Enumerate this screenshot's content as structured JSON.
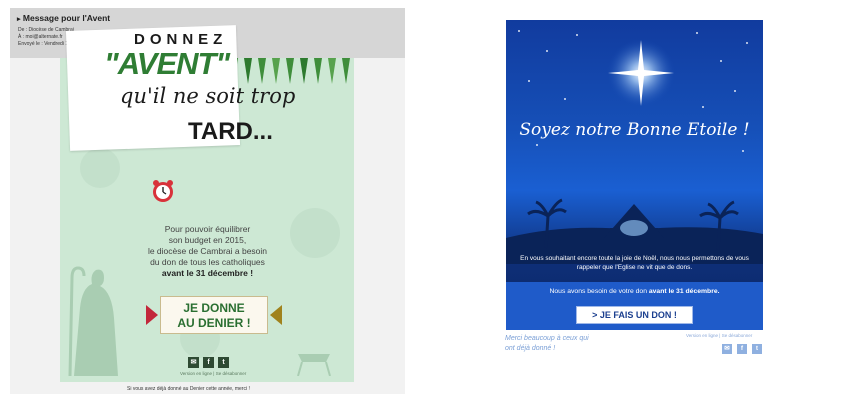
{
  "mail": {
    "subject": "Message pour l'Avent",
    "from": "De : Diocèse de Cambrai",
    "to": "À : moi@alternate.fr",
    "sent": "Envoyé le : Vendredi 18 décembre 2015 - 15:40"
  },
  "email1": {
    "donnez": "DONNEZ",
    "avent": "\"AVENT\"",
    "quil": "qu'il ne soit trop",
    "tard": "TARD...",
    "body": [
      "Pour pouvoir équilibrer",
      "son budget en 2015,",
      "le diocèse de Cambrai a besoin",
      "du don de tous les catholiques"
    ],
    "body_bold": "avant le 31 décembre !",
    "button_line1": "JE DONNE",
    "button_line2": "AU DENIER !",
    "social": [
      "✉",
      "f",
      "t"
    ],
    "links": "Version en ligne  |  Se désabonner",
    "footer": "Si vous avez déjà donné au Denier cette année, merci !"
  },
  "email2": {
    "title": "Soyez notre Bonne Etoile !",
    "text1": "En vous souhaitant encore toute la joie de Noël, nous nous permettons de vous rappeler que l'Eglise ne vit que de dons.",
    "text2_pre": "Nous avons besoin de votre don ",
    "text2_bold": "avant le 31 décembre.",
    "button": "> JE FAIS UN DON !",
    "thanks_line1": "Merci beaucoup à ceux qui",
    "thanks_line2": "ont déjà donné !",
    "links": "Version en ligne  |  Se désabonner",
    "social": [
      "✉",
      "f",
      "t"
    ]
  },
  "colors": {
    "email1_bg": "#cde8d4",
    "green_accent": "#2f7d34",
    "red_arrow": "#c2273a",
    "gold_arrow": "#a0821c",
    "email2_blue": "#1a5fd2"
  }
}
